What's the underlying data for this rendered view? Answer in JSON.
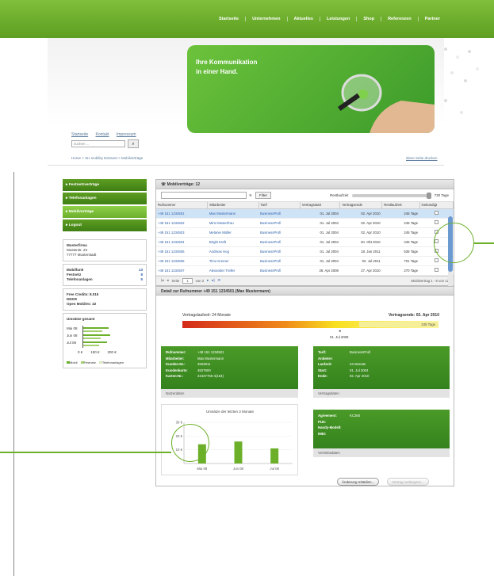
{
  "topnav": [
    "Startseite",
    "Unternehmen",
    "Aktuelles",
    "Leistungen",
    "Shop",
    "Referenzen",
    "Partner"
  ],
  "hero": {
    "line1": "Ihre Kommunikation",
    "line2": "in einer Hand."
  },
  "util": {
    "links": [
      "Startseite",
      "Kontakt",
      "Impressum"
    ],
    "search_placeholder": "suchen ..."
  },
  "breadcrumb": "Home > SH mobility Extranet > Mobilverträge",
  "print_link": "diese Seite drucken",
  "sidebar": {
    "nav": [
      "Festnetzverträge",
      "Telefonanlagen",
      "Mobilverträge",
      "Logout"
    ],
    "company": {
      "name": "Musterfirma",
      "street": "Musterstr. 23",
      "city": "77777 Musterstadt"
    },
    "counts": [
      {
        "label": "Mobilfunk",
        "value": "13"
      },
      {
        "label": "Festnetz",
        "value": "8"
      },
      {
        "label": "Telefonanlagen",
        "value": "5"
      }
    ],
    "credits": {
      "free": "Free Credits: 8.015",
      "ddkr": "DDKR",
      "open": "Open Mobiles: 42"
    },
    "revenue_title": "Umsätze gesamt",
    "revenue_months": [
      "Mai 08",
      "Jun 08",
      "Jul 08"
    ],
    "revenue_ticks": [
      "0 €",
      "150 €",
      "300 €"
    ],
    "legend": [
      "Mobil",
      "Festnetz",
      "Telefonanlagen"
    ]
  },
  "main": {
    "title": "Mobilverträge: 12",
    "filter_label": "Filter",
    "slider_label": "Restlaufzeit",
    "slider_value": "730 Tage",
    "columns": [
      "Rufnummer",
      "Mitarbeiter",
      "Tarif",
      "Vertragsstart",
      "Vertragsende",
      "Restlaufzeit",
      "Gekündigt"
    ],
    "rows": [
      [
        "+49 151 1234501",
        "Max Mustermann",
        "BusinessProfi",
        "01. Jul 2004",
        "02. Apr 2010",
        "245 Tage"
      ],
      [
        "+49 151 1234502",
        "Mimi Musterfrau",
        "BusinessProfi",
        "01. Jul 2004",
        "02. Apr 2010",
        "245 Tage"
      ],
      [
        "+49 151 1234503",
        "Melanie Müller",
        "BusinessProfi",
        "01. Jul 2004",
        "02. Apr 2010",
        "245 Tage"
      ],
      [
        "+49 151 1234504",
        "Birgitt Kraft",
        "BusinessProfi",
        "01. Jul 2004",
        "20. Okt 2010",
        "445 Tage"
      ],
      [
        "+49 151 1234505",
        "Andreas Hog",
        "BusinessProfi",
        "01. Jul 2004",
        "18. Jan 2011",
        "536 Tage"
      ],
      [
        "+49 151 1234506",
        "Timo Kremer",
        "BusinessProfi",
        "01. Jul 2004",
        "02. Jul 2011",
        "701 Tage"
      ],
      [
        "+49 151 1234507",
        "Alexander Treller",
        "BusinessProfi",
        "28. Apr 2008",
        "27. Apr 2010",
        "270 Tage"
      ]
    ],
    "pager": {
      "page_label": "Seite",
      "page": "1",
      "of": "von 2",
      "status": "Mobilvertrag 1 - 6 von 12"
    },
    "detail_title": "Detail zur Rufnummer +49 151 1234501 (Max Mustermann)",
    "term_label": "Vertragslaufzeit: 24 Monate",
    "end_label": "Vertragsende: 02. Apr 2010",
    "bar_value": "245 Tage",
    "bar_fraction": 0.66,
    "date_marker": "01. Jul 2009",
    "user_card": {
      "rows": [
        [
          "Rufnummer:",
          "+49 151 1234501"
        ],
        [
          "Mitarbeiter:",
          "Max Mustermann"
        ],
        [
          "Kunden-Nr.:",
          "4553811"
        ],
        [
          "Kundenkarte:",
          "4827900"
        ],
        [
          "Karten-Nr.:",
          "24437765-4(164)"
        ]
      ],
      "footer": "Nutzerdaten"
    },
    "contract_card": {
      "rows": [
        [
          "Tarif:",
          "BusinessProfi"
        ],
        [
          "Anbieter:",
          ""
        ],
        [
          "Laufzeit:",
          "24 Monate"
        ],
        [
          "Start:",
          "01. Jul 2004"
        ],
        [
          "Ende:",
          "02. Apr 2010"
        ]
      ],
      "footer": "Vertragsdaten"
    },
    "device_card": {
      "rows": [
        [
          "Agreement:",
          "KC360"
        ],
        [
          "PUK:",
          ""
        ],
        [
          "Handy-Modell:",
          ""
        ],
        [
          "IMEI:",
          ""
        ]
      ],
      "footer": "Vertriebsdaten"
    },
    "btn_change": "Änderung mitteilen...",
    "btn_extend": "Vertrag verlängern..."
  },
  "chart_data": {
    "type": "bar",
    "title": "Umsätze der letzten 3 Monate",
    "categories": [
      "Mai 08",
      "Jun 08",
      "Jul 08"
    ],
    "values": [
      14,
      16,
      11
    ],
    "ytick_labels": [
      "10 €",
      "20 €",
      "30 €"
    ],
    "ylim": [
      0,
      30
    ]
  }
}
